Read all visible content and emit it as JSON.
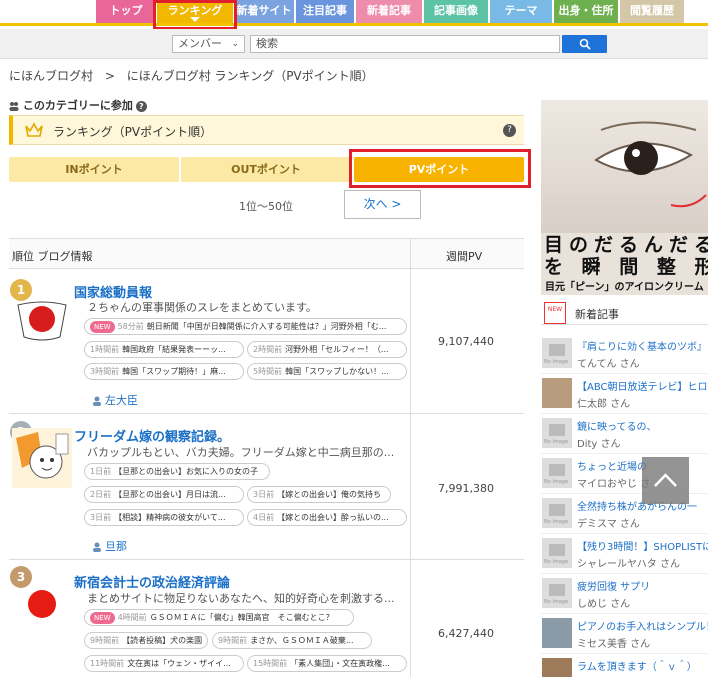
{
  "nav": {
    "tabs": [
      {
        "label": "トップ",
        "color": "#e9669a"
      },
      {
        "label": "ランキング",
        "color": "#f2b800"
      },
      {
        "label": "新着サイト",
        "color": "#7aa3e0"
      },
      {
        "label": "注目記事",
        "color": "#6a94dc"
      },
      {
        "label": "新着記事",
        "color": "#ee8cac"
      },
      {
        "label": "記事画像",
        "color": "#5cc3a4"
      },
      {
        "label": "テーマ",
        "color": "#79b9e5"
      },
      {
        "label": "出身・住所",
        "color": "#6fb04e"
      },
      {
        "label": "閲覧履歴",
        "color": "#d4c7a8"
      }
    ]
  },
  "search": {
    "select_value": "メンバー",
    "placeholder": "検索"
  },
  "breadcrumb": {
    "home": "にほんブログ村",
    "sep": ">",
    "current": "にほんブログ村 ランキング（PVポイント順）"
  },
  "join_label": "このカテゴリーに参加",
  "ranking_title": "ランキング（PVポイント順）",
  "segments": [
    "INポイント",
    "OUTポイント",
    "PVポイント"
  ],
  "pager": {
    "range": "1位〜50位",
    "next": "次へ >"
  },
  "table": {
    "col_rank": "順位 ブログ情報",
    "col_pv": "週間PV"
  },
  "entries": [
    {
      "rank": "1",
      "title": "国家総動員報",
      "desc": "２ちゃんの軍事関係のスレをまとめています。",
      "pills": [
        {
          "new": "NEW",
          "time": "58分前",
          "text": "朝日新聞「中国が日韓関係に介入する可能性は？」河野外相「む..."
        },
        {
          "time": "1時間前",
          "text": "韓国政府「結果発表ーーッ..."
        },
        {
          "time": "2時間前",
          "text": "河野外相「セルフィー！（..."
        },
        {
          "time": "3時間前",
          "text": "韓国「スワップ期待！」麻..."
        },
        {
          "time": "5時間前",
          "text": "韓国「スワップしかない！..."
        }
      ],
      "author": "左大臣",
      "pv": "9,107,440"
    },
    {
      "rank": "2",
      "title": "フリーダム嫁の観察記録。",
      "desc": "バカップルもとい、バカ夫婦。フリーダム嫁と中二病旦那の...",
      "pills": [
        {
          "time": "1日前",
          "text": "【旦那との出会い】お気に入りの女の子"
        },
        {
          "time": "2日前",
          "text": "【旦那との出会い】月日は流..."
        },
        {
          "time": "3日前",
          "text": "【嫁との出会い】俺の気持ち"
        },
        {
          "time": "3日前",
          "text": "【相談】精神病の彼女がいて..."
        },
        {
          "time": "4日前",
          "text": "【嫁との出会い】酔っ払いの..."
        }
      ],
      "author": "旦那",
      "pv": "7,991,380"
    },
    {
      "rank": "3",
      "title": "新宿会計士の政治経済評論",
      "desc": "まとめサイトに物足りないあなたへ、知的好奇心を刺激する...",
      "pills": [
        {
          "new": "NEW",
          "time": "4時間前",
          "text": "ＧＳＯＭＩＡに「偏む」韓国高官　そこ偏むとこ？"
        },
        {
          "time": "9時間前",
          "text": "【読者投稿】犬の楽園"
        },
        {
          "time": "9時間前",
          "text": "まさか、ＧＳＯＭＩＡ破棄..."
        },
        {
          "time": "11時間前",
          "text": "文在寅は「ウェン・ザイイ..."
        },
        {
          "time": "15時間前",
          "text": "「素人集団」・文在寅政権..."
        }
      ],
      "pv": "6,427,440"
    }
  ],
  "ad": {
    "headline": "目のだるんだる",
    "headline2": "を 瞬 間 整 形",
    "sub": "目元「ピーン」のアイロンクリーム"
  },
  "sidebar": {
    "new_articles_label": "新着記事",
    "new_icon_text": "NEW",
    "noimage_label": "No Image",
    "items": [
      {
        "title": "『肩こりに効く基本のツボ』",
        "who": "てんてん さん"
      },
      {
        "title": "【ABC朝日放送テレビ】ヒロド",
        "who": "仁太郎 さん"
      },
      {
        "title": "鏡に映ってるの、",
        "who": "Dity さん"
      },
      {
        "title": "ちょっと近場の",
        "who": "マイロおやじ さ"
      },
      {
        "title": "全然持ち株があがらんの一",
        "who": "デミスマ さん"
      },
      {
        "title": "【残り3時間！】SHOPLISTに",
        "who": "シャレールヤハタ さん"
      },
      {
        "title": "疲労回復 サプリ",
        "who": "しめじ さん"
      },
      {
        "title": "ピアノのお手入れはシンプル！",
        "who": "ミセス美香 さん"
      },
      {
        "title": "ラムを頂きます（＾ｖ＾）",
        "who": ""
      }
    ]
  }
}
